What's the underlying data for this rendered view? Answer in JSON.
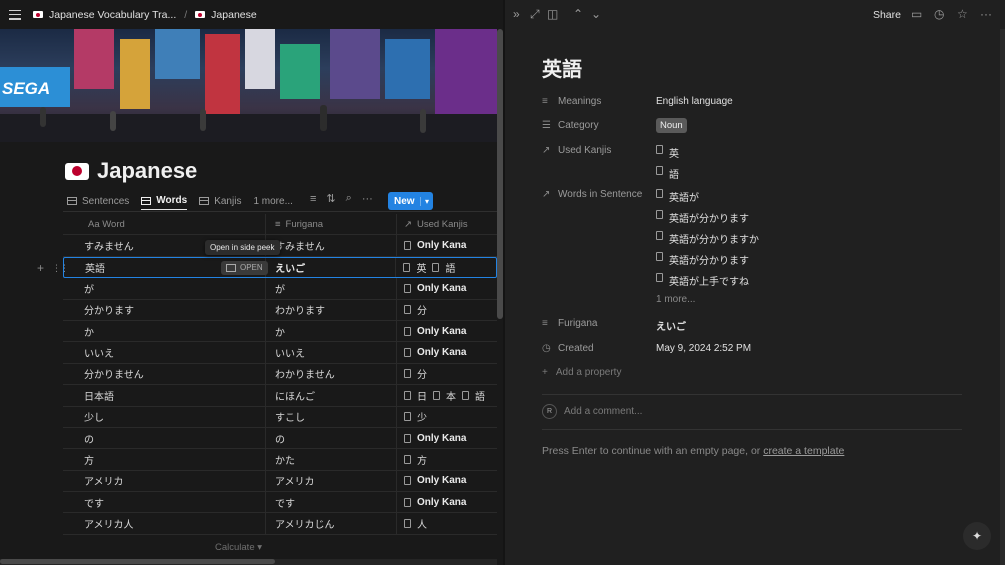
{
  "breadcrumb": {
    "item1": "Japanese Vocabulary Tra...",
    "sep": "/",
    "item2": "Japanese"
  },
  "page": {
    "title": "Japanese"
  },
  "cover": {
    "sign1": "SEGA"
  },
  "views": {
    "tabs": [
      "Sentences",
      "Words",
      "Kanjis"
    ],
    "active": "Words",
    "more": "1 more...",
    "new_label": "New"
  },
  "table": {
    "headers": {
      "word": "Aa Word",
      "furigana": "Furigana",
      "kanjis": "Used Kanjis"
    },
    "rows": [
      {
        "word": "すみません",
        "furigana": "すみません",
        "kanjis": [
          "Only Kana"
        ]
      },
      {
        "word": "英語",
        "furigana": "えいご",
        "kanjis": [
          "英",
          "語"
        ]
      },
      {
        "word": "が",
        "furigana": "が",
        "kanjis": [
          "Only Kana"
        ]
      },
      {
        "word": "分かります",
        "furigana": "わかります",
        "kanjis": [
          "分"
        ]
      },
      {
        "word": "か",
        "furigana": "か",
        "kanjis": [
          "Only Kana"
        ]
      },
      {
        "word": "いいえ",
        "furigana": "いいえ",
        "kanjis": [
          "Only Kana"
        ]
      },
      {
        "word": "分かりません",
        "furigana": "わかりません",
        "kanjis": [
          "分"
        ]
      },
      {
        "word": "日本語",
        "furigana": "にほんご",
        "kanjis": [
          "日",
          "本",
          "語"
        ]
      },
      {
        "word": "少し",
        "furigana": "すこし",
        "kanjis": [
          "少"
        ]
      },
      {
        "word": "の",
        "furigana": "の",
        "kanjis": [
          "Only Kana"
        ]
      },
      {
        "word": "方",
        "furigana": "かた",
        "kanjis": [
          "方"
        ]
      },
      {
        "word": "アメリカ",
        "furigana": "アメリカ",
        "kanjis": [
          "Only Kana"
        ]
      },
      {
        "word": "です",
        "furigana": "です",
        "kanjis": [
          "Only Kana"
        ]
      },
      {
        "word": "アメリカ人",
        "furigana": "アメリカじん",
        "kanjis": [
          "人"
        ]
      }
    ],
    "open_label": "OPEN",
    "tooltip": "Open in side peek",
    "calculate": "Calculate"
  },
  "peek": {
    "share": "Share",
    "title": "英語",
    "props": {
      "meanings": {
        "name": "Meanings",
        "value": "English language"
      },
      "category": {
        "name": "Category",
        "value": "Noun"
      },
      "used_kanjis": {
        "name": "Used Kanjis",
        "values": [
          "英",
          "語"
        ]
      },
      "words_in_sentence": {
        "name": "Words in Sentence",
        "values": [
          "英語が",
          "英語が分かります",
          "英語が分かりますか",
          "英語が分かります",
          "英語が上手ですね"
        ],
        "more": "1 more..."
      },
      "furigana": {
        "name": "Furigana",
        "value": "えいご"
      },
      "created": {
        "name": "Created",
        "value": "May 9, 2024 2:52 PM"
      }
    },
    "add_property": "Add a property",
    "comment_placeholder": "Add a comment...",
    "avatar_initial": "R",
    "hint_prefix": "Press Enter to continue with an empty page, or ",
    "hint_link": "create a template"
  }
}
